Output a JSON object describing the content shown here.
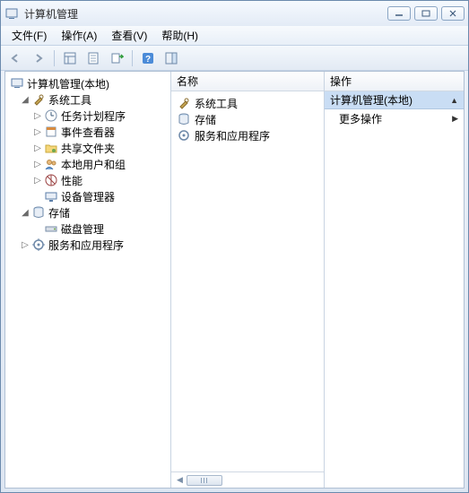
{
  "window": {
    "title": "计算机管理"
  },
  "menu": {
    "file": "文件(F)",
    "action": "操作(A)",
    "view": "查看(V)",
    "help": "帮助(H)"
  },
  "tree": {
    "root": "计算机管理(本地)",
    "system_tools": "系统工具",
    "task_scheduler": "任务计划程序",
    "event_viewer": "事件查看器",
    "shared_folders": "共享文件夹",
    "local_users": "本地用户和组",
    "performance": "性能",
    "device_manager": "设备管理器",
    "storage": "存储",
    "disk_management": "磁盘管理",
    "services_apps": "服务和应用程序"
  },
  "mid": {
    "header": "名称",
    "items": {
      "system_tools": "系统工具",
      "storage": "存储",
      "services_apps": "服务和应用程序"
    }
  },
  "right": {
    "header": "操作",
    "title": "计算机管理(本地)",
    "more_actions": "更多操作"
  }
}
